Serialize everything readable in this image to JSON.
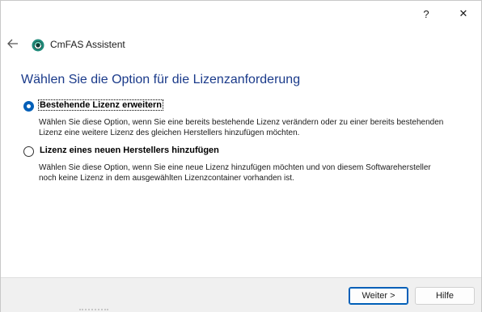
{
  "titlebar": {
    "help_label": "?",
    "close_label": "✕"
  },
  "header": {
    "app_title": "CmFAS Assistent",
    "back_icon": "arrow-left-icon",
    "logo_icon": "cmfas-logo-icon",
    "logo_color": "#1f8a7a"
  },
  "page": {
    "title": "Wählen Sie die Option für die Lizenzanforderung"
  },
  "options": [
    {
      "label": "Bestehende Lizenz erweitern",
      "selected": true,
      "description_line1": "Wählen Sie diese Option, wenn Sie eine bereits bestehende Lizenz verändern oder zu einer bereits bestehenden",
      "description_line2": "Lizenz eine weitere Lizenz des gleichen Herstellers hinzufügen möchten."
    },
    {
      "label": "Lizenz eines neuen Herstellers hinzufügen",
      "selected": false,
      "description_line1": "Wählen Sie diese Option, wenn Sie eine neue Lizenz hinzufügen möchten und von diesem Softwarehersteller",
      "description_line2": "noch keine Lizenz in dem ausgewählten Lizenzcontainer vorhanden ist."
    }
  ],
  "footer": {
    "next_label": "Weiter >",
    "help_label": "Hilfe"
  },
  "colors": {
    "title": "#1a3a8a",
    "accent": "#005fb8"
  }
}
